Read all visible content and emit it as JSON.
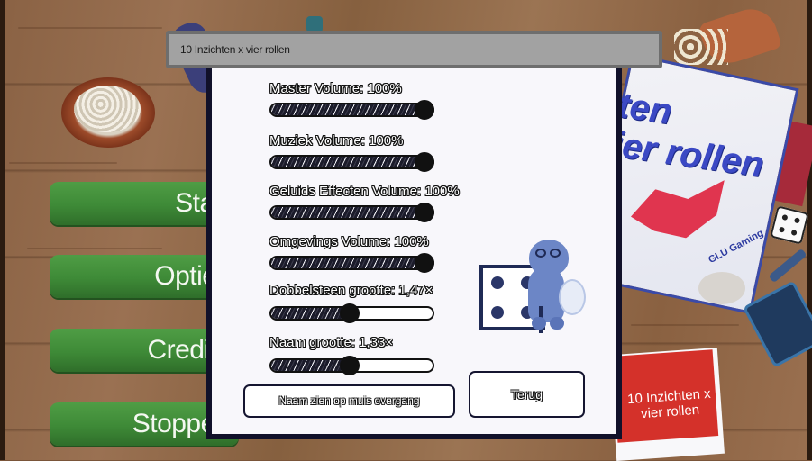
{
  "window": {
    "title": "10 Inzichten x vier rollen"
  },
  "main_menu": {
    "items": [
      {
        "label": "Start"
      },
      {
        "label": "Opties"
      },
      {
        "label": "Credits"
      },
      {
        "label": "Stoppen"
      }
    ],
    "button_color": "#3e8a37"
  },
  "options": {
    "sliders": [
      {
        "label": "Master Volume: 100%",
        "value": 1.0
      },
      {
        "label": "Muziek Volume: 100%",
        "value": 1.0
      },
      {
        "label": "Geluids Effecten Volume: 100%",
        "value": 1.0
      },
      {
        "label": "Omgevings Volume: 100%",
        "value": 1.0
      },
      {
        "label": "Dobbelsteen grootte: 1,47×",
        "value": 0.47
      },
      {
        "label": "Naam grootte: 1,33×",
        "value": 0.47
      }
    ],
    "hover_name_button": "Naam zien op muis overgang",
    "back_button": "Terug",
    "panel_border_color": "#11112a"
  },
  "background": {
    "box_title": "ten\nier rollen",
    "box_brand": "GLU Gaming",
    "flyer_title": "10 Inzichten x vier rollen",
    "table_color": "#8a6244"
  }
}
